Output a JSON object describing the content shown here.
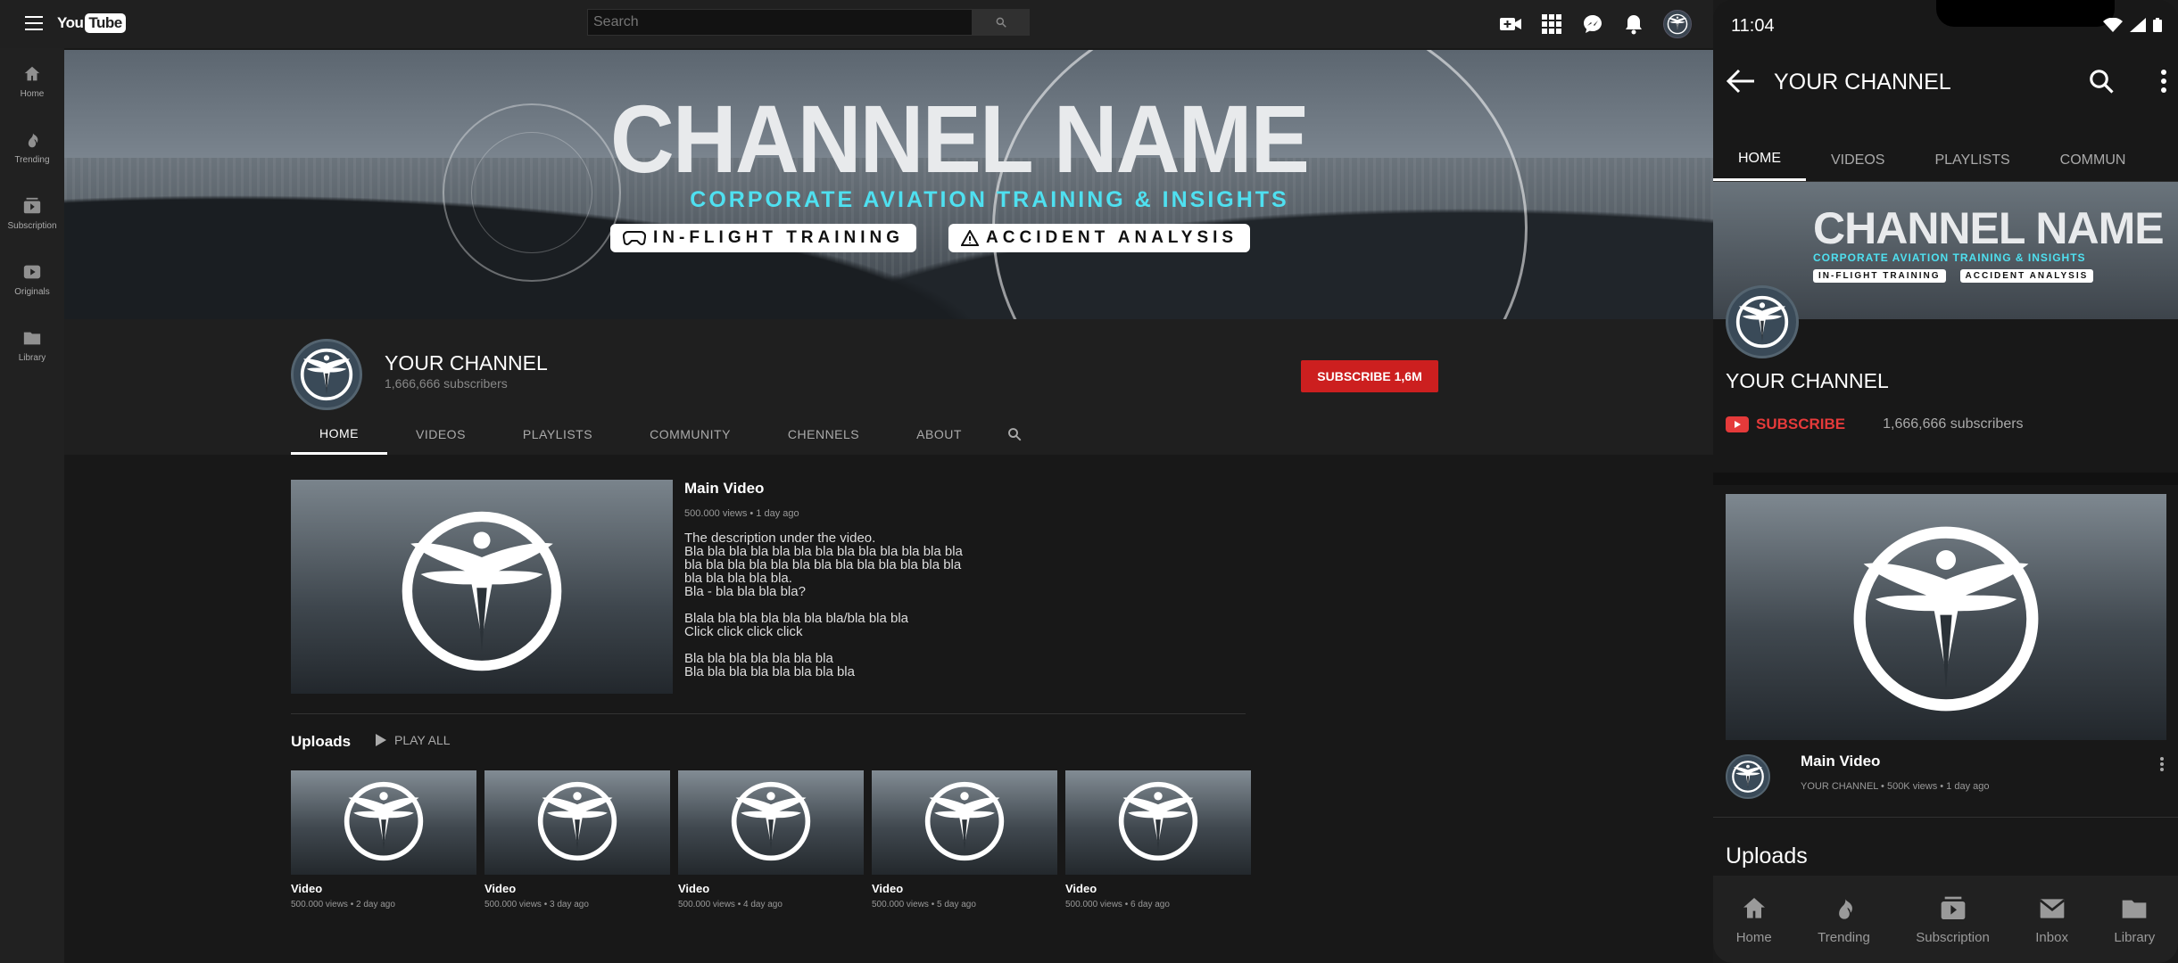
{
  "desktop": {
    "logo": {
      "you": "You",
      "tube": "Tube"
    },
    "search": {
      "placeholder": "Search"
    },
    "icons": [
      "video-camera-icon",
      "apps-grid-icon",
      "messages-icon",
      "bell-icon",
      "account-avatar-icon"
    ],
    "leftnav": [
      {
        "label": "Home",
        "icon": "home-icon"
      },
      {
        "label": "Trending",
        "icon": "flame-icon"
      },
      {
        "label": "Subscription",
        "icon": "subscriptions-icon"
      },
      {
        "label": "Originals",
        "icon": "play-box-icon"
      },
      {
        "label": "Library",
        "icon": "folder-icon"
      }
    ],
    "banner": {
      "title": "CHANNEL NAME",
      "subtitle": "CORPORATE AVIATION TRAINING & INSIGHTS",
      "pill1": "IN-FLIGHT TRAINING",
      "pill2": "ACCIDENT ANALYSIS"
    },
    "channel": {
      "name": "YOUR CHANNEL",
      "subscribers": "1,666,666 subscribers",
      "subscribe_button": "SUBSCRIBE 1,6M"
    },
    "tabs": [
      "HOME",
      "VIDEOS",
      "PLAYLISTS",
      "COMMUNITY",
      "CHENNELS",
      "ABOUT"
    ],
    "main_video": {
      "title": "Main Video",
      "meta": "500.000 views • 1 day ago",
      "description": "The description under the video.\nBla bla bla bla bla bla bla bla bla bla bla bla bla\nbla bla bla bla bla bla bla bla bla bla bla bla bla\nbla bla bla bla bla.\nBla -  bla bla bla bla?\n\nBlala  bla bla bla bla bla bla/bla bla bla\nClick click click click\n\nBla bla bla bla bla bla bla\nBla bla bla bla bla bla bla bla"
    },
    "uploads": {
      "title": "Uploads",
      "play_all": "PLAY ALL",
      "videos": [
        {
          "title": "Video",
          "meta": "500.000 views • 2 day ago"
        },
        {
          "title": "Video",
          "meta": "500.000 views • 3 day ago"
        },
        {
          "title": "Video",
          "meta": "500.000 views • 4 day ago"
        },
        {
          "title": "Video",
          "meta": "500.000 views • 5 day ago"
        },
        {
          "title": "Video",
          "meta": "500.000 views • 6 day ago"
        }
      ]
    }
  },
  "mobile": {
    "time": "11:04",
    "title": "YOUR CHANNEL",
    "tabs": [
      "HOME",
      "VIDEOS",
      "PLAYLISTS",
      "COMMUN"
    ],
    "banner": {
      "title": "CHANNEL NAME",
      "subtitle": "CORPORATE AVIATION TRAINING & INSIGHTS",
      "pill1": "IN-FLIGHT TRAINING",
      "pill2": "ACCIDENT ANALYSIS"
    },
    "channel_name": "YOUR CHANNEL",
    "subscribe": "SUBSCRIBE",
    "subscribers": "1,666,666 subscribers",
    "video": {
      "title": "Main Video",
      "meta": "YOUR CHANNEL • 500K views • 1 day ago"
    },
    "uploads": "Uploads",
    "nav": [
      {
        "label": "Home",
        "icon": "home-icon"
      },
      {
        "label": "Trending",
        "icon": "flame-icon"
      },
      {
        "label": "Subscription",
        "icon": "subscriptions-icon"
      },
      {
        "label": "Inbox",
        "icon": "inbox-icon"
      },
      {
        "label": "Library",
        "icon": "folder-icon"
      }
    ]
  },
  "colors": {
    "accent_red": "#cc1f1f",
    "cyan": "#4fe0f0",
    "bg": "#181818"
  }
}
